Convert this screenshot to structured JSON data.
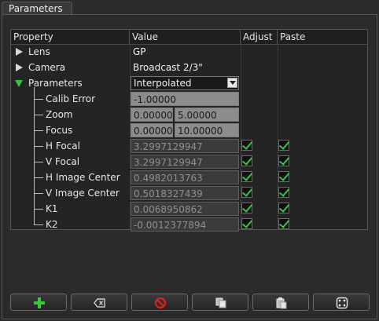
{
  "panel": {
    "title": "Parameters"
  },
  "tree": {
    "headers": [
      "Property",
      "Value",
      "Adjust",
      "Paste"
    ],
    "rows": [
      {
        "label": "Lens",
        "value": "GP"
      },
      {
        "label": "Camera",
        "value": "Broadcast 2/3\""
      },
      {
        "label": "Parameters",
        "value": "Interpolated"
      },
      {
        "label": "Calib Error",
        "value": "-1.00000"
      },
      {
        "label": "Zoom",
        "value_min": "0.00000",
        "value_max": "5.00000"
      },
      {
        "label": "Focus",
        "value_min": "0.00000",
        "value_max": "10.00000"
      },
      {
        "label": "H Focal",
        "value": "3.2997129947"
      },
      {
        "label": "V Focal",
        "value": "3.2997129947"
      },
      {
        "label": "H Image Center",
        "value": "0.4982013763"
      },
      {
        "label": "V Image Center",
        "value": "0.5018327439"
      },
      {
        "label": "K1",
        "value": "0.0068950862"
      },
      {
        "label": "K2",
        "value": "-0.0012377894"
      }
    ]
  },
  "toolbar": {
    "buttons": [
      {
        "name": "add",
        "icon": "plus-icon"
      },
      {
        "name": "clear",
        "icon": "backspace-icon"
      },
      {
        "name": "disable",
        "icon": "no-entry-icon"
      },
      {
        "name": "copy",
        "icon": "copy-icon"
      },
      {
        "name": "paste",
        "icon": "paste-icon"
      },
      {
        "name": "center",
        "icon": "target-icon"
      }
    ],
    "colors": {
      "add": "#3cc43c",
      "disable": "#e02020"
    }
  }
}
